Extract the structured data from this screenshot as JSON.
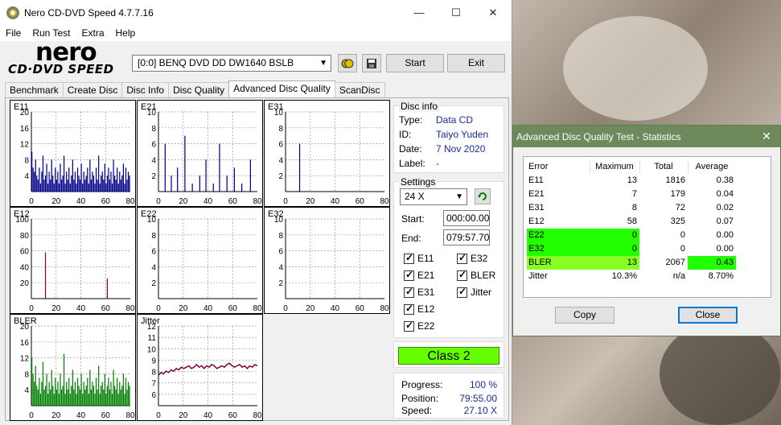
{
  "window": {
    "title": "Nero CD-DVD Speed 4.7.7.16",
    "min": "—",
    "max": "☐",
    "close": "✕"
  },
  "menu": [
    "File",
    "Run Test",
    "Extra",
    "Help"
  ],
  "logo": {
    "top": "nero",
    "bottom": "CD·DVD SPEED"
  },
  "drive": "[0:0]   BENQ DVD DD DW1640 BSLB",
  "toolbar": {
    "start": "Start",
    "exit": "Exit"
  },
  "tabs": [
    "Benchmark",
    "Create Disc",
    "Disc Info",
    "Disc Quality",
    "Advanced Disc Quality",
    "ScanDisc"
  ],
  "active_tab": 4,
  "disc_info": {
    "heading": "Disc info",
    "type_label": "Type:",
    "type": "Data CD",
    "id_label": "ID:",
    "id": "Taiyo Yuden",
    "date_label": "Date:",
    "date": "7 Nov 2020",
    "label_label": "Label:",
    "label": "-"
  },
  "settings": {
    "heading": "Settings",
    "speed": "24 X",
    "start_label": "Start:",
    "start": "000:00.00",
    "end_label": "End:",
    "end": "079:57.70"
  },
  "checks": {
    "e11": "E11",
    "e21": "E21",
    "e31": "E31",
    "e12": "E12",
    "e22": "E22",
    "e32": "E32",
    "bler": "BLER",
    "jitter": "Jitter"
  },
  "class": "Class 2",
  "progress": {
    "progress_label": "Progress:",
    "progress": "100 %",
    "position_label": "Position:",
    "position": "79:55.00",
    "speed_label": "Speed:",
    "speed": "27.10 X"
  },
  "colors": {
    "accent_green": "#66ff00",
    "bar_blue": "#00008b",
    "bar_green": "#008000",
    "jitter": "#800040",
    "dialog_title": "#6c8a5c"
  },
  "stats": {
    "title": "Advanced Disc Quality Test - Statistics",
    "close": "✕",
    "headers": [
      "Error",
      "Maximum",
      "Total",
      "Average"
    ],
    "rows": [
      [
        "E11",
        "13",
        "1816",
        "0.38"
      ],
      [
        "E21",
        "7",
        "179",
        "0.04"
      ],
      [
        "E31",
        "8",
        "72",
        "0.02"
      ],
      [
        "E12",
        "58",
        "325",
        "0.07"
      ],
      [
        "E22",
        "0",
        "0",
        "0.00"
      ],
      [
        "E32",
        "0",
        "0",
        "0.00"
      ],
      [
        "BLER",
        "13",
        "2067",
        "0.43"
      ],
      [
        "Jitter",
        "10.3%",
        "n/a",
        "8.70%"
      ]
    ],
    "copy": "Copy",
    "close_btn": "Close"
  },
  "chart_data": [
    {
      "type": "bar",
      "title": "E11",
      "ylim": [
        0,
        20
      ],
      "yticks": [
        "20",
        "16",
        "12",
        "8",
        "4"
      ],
      "xticks": [
        "0",
        "20",
        "40",
        "60",
        "80"
      ],
      "color": "#00008b",
      "values": [
        10,
        6,
        5,
        8,
        4,
        3,
        6,
        2,
        5,
        9,
        3,
        4,
        7,
        2,
        5,
        3,
        8,
        4,
        2,
        6,
        3,
        5,
        2,
        7,
        3,
        4,
        9,
        2,
        5,
        3,
        6,
        2,
        4,
        8,
        3,
        5,
        2,
        6,
        4,
        3,
        7,
        2,
        5,
        3,
        4,
        6,
        2,
        8,
        3,
        5,
        4,
        2,
        6,
        3,
        9,
        2,
        4,
        5,
        3,
        7,
        2,
        4,
        6,
        3,
        5,
        2,
        8,
        4,
        3,
        6,
        2,
        5,
        3,
        4,
        7,
        2,
        6,
        3,
        5,
        4
      ]
    },
    {
      "type": "bar",
      "title": "E21",
      "ylim": [
        0,
        10
      ],
      "yticks": [
        "10",
        "8",
        "6",
        "4",
        "2"
      ],
      "xticks": [
        "0",
        "20",
        "40",
        "60",
        "80"
      ],
      "color": "#00008b",
      "values": [
        0,
        0,
        0,
        0,
        0,
        6,
        0,
        0,
        0,
        0,
        2,
        0,
        0,
        0,
        0,
        3,
        0,
        0,
        0,
        0,
        0,
        7,
        0,
        0,
        0,
        0,
        0,
        1,
        0,
        0,
        0,
        0,
        0,
        2,
        0,
        0,
        0,
        0,
        4,
        0,
        0,
        0,
        0,
        0,
        1,
        0,
        0,
        0,
        0,
        6,
        0,
        0,
        0,
        0,
        0,
        2,
        0,
        0,
        0,
        0,
        0,
        3,
        0,
        0,
        0,
        0,
        0,
        1,
        0,
        0,
        0,
        0,
        0,
        0,
        4,
        0,
        0,
        0,
        0,
        0
      ]
    },
    {
      "type": "bar",
      "title": "E31",
      "ylim": [
        0,
        10
      ],
      "yticks": [
        "10",
        "8",
        "6",
        "4",
        "2"
      ],
      "xticks": [
        "0",
        "20",
        "40",
        "60",
        "80"
      ],
      "color": "#00008b",
      "values": [
        0,
        0,
        0,
        0,
        0,
        0,
        0,
        0,
        0,
        0,
        0,
        6,
        0,
        0,
        0,
        0,
        0,
        0,
        0,
        0,
        0,
        0,
        0,
        0,
        0,
        0,
        0,
        0,
        0,
        0,
        0,
        0,
        0,
        0,
        0,
        0,
        0,
        0,
        0,
        0,
        0,
        0,
        0,
        0,
        0,
        0,
        0,
        0,
        0,
        0,
        0,
        0,
        0,
        0,
        0,
        0,
        0,
        0,
        0,
        0,
        0,
        0,
        0,
        0,
        0,
        0,
        0,
        0,
        0,
        0,
        0,
        0,
        0,
        0,
        0,
        0,
        0,
        0,
        0,
        0
      ]
    },
    {
      "type": "bar",
      "title": "E12",
      "ylim": [
        0,
        100
      ],
      "yticks": [
        "100",
        "80",
        "60",
        "40",
        "20"
      ],
      "xticks": [
        "0",
        "20",
        "40",
        "60",
        "80"
      ],
      "color": "#800040",
      "values": [
        0,
        0,
        0,
        0,
        0,
        0,
        0,
        0,
        0,
        0,
        0,
        58,
        0,
        0,
        0,
        0,
        0,
        0,
        0,
        0,
        0,
        0,
        0,
        0,
        0,
        0,
        0,
        0,
        0,
        0,
        0,
        0,
        0,
        0,
        0,
        0,
        0,
        0,
        0,
        0,
        0,
        0,
        0,
        0,
        0,
        0,
        0,
        0,
        0,
        0,
        0,
        0,
        0,
        0,
        0,
        0,
        0,
        0,
        0,
        0,
        0,
        25,
        0,
        0,
        0,
        0,
        0,
        0,
        0,
        0,
        0,
        0,
        0,
        0,
        0,
        0,
        0,
        0,
        0,
        0
      ]
    },
    {
      "type": "bar",
      "title": "E22",
      "ylim": [
        0,
        10
      ],
      "yticks": [
        "10",
        "8",
        "6",
        "4",
        "2"
      ],
      "xticks": [
        "0",
        "20",
        "40",
        "60",
        "80"
      ],
      "color": "#00008b",
      "values": []
    },
    {
      "type": "bar",
      "title": "E32",
      "ylim": [
        0,
        10
      ],
      "yticks": [
        "10",
        "8",
        "6",
        "4",
        "2"
      ],
      "xticks": [
        "0",
        "20",
        "40",
        "60",
        "80"
      ],
      "color": "#00008b",
      "values": []
    },
    {
      "type": "bar",
      "title": "BLER",
      "ylim": [
        0,
        20
      ],
      "yticks": [
        "20",
        "16",
        "12",
        "8",
        "4"
      ],
      "xticks": [
        "0",
        "20",
        "40",
        "60",
        "80"
      ],
      "color": "#008000",
      "values": [
        12,
        8,
        6,
        10,
        5,
        4,
        7,
        3,
        6,
        11,
        4,
        5,
        8,
        3,
        6,
        4,
        9,
        5,
        3,
        7,
        4,
        6,
        3,
        8,
        4,
        5,
        13,
        3,
        6,
        4,
        7,
        3,
        5,
        9,
        4,
        6,
        3,
        7,
        5,
        4,
        8,
        3,
        6,
        4,
        5,
        7,
        3,
        9,
        4,
        6,
        5,
        3,
        7,
        4,
        10,
        3,
        5,
        6,
        4,
        8,
        3,
        5,
        7,
        4,
        6,
        3,
        9,
        5,
        4,
        7,
        3,
        6,
        4,
        5,
        8,
        3,
        7,
        4,
        6,
        5
      ]
    },
    {
      "type": "line",
      "title": "Jitter",
      "ylim": [
        6,
        12
      ],
      "yticks": [
        "12",
        "11",
        "10",
        "9",
        "8",
        "7",
        "6"
      ],
      "xticks": [
        "0",
        "20",
        "40",
        "60",
        "80"
      ],
      "color": "#800040",
      "values": [
        8.3,
        8.5,
        8.4,
        8.6,
        8.5,
        8.7,
        8.6,
        8.8,
        8.7,
        8.9,
        8.8,
        8.9,
        9.0,
        8.8,
        8.9,
        9.1,
        8.9,
        9.0,
        8.8,
        9.0,
        8.9,
        9.1,
        9.0,
        8.8,
        8.9,
        9.0,
        8.9,
        9.1,
        9.2,
        9.0,
        8.9,
        9.0,
        9.1,
        8.9,
        9.0,
        8.8,
        9.0,
        8.9,
        9.1,
        9.0
      ]
    }
  ]
}
